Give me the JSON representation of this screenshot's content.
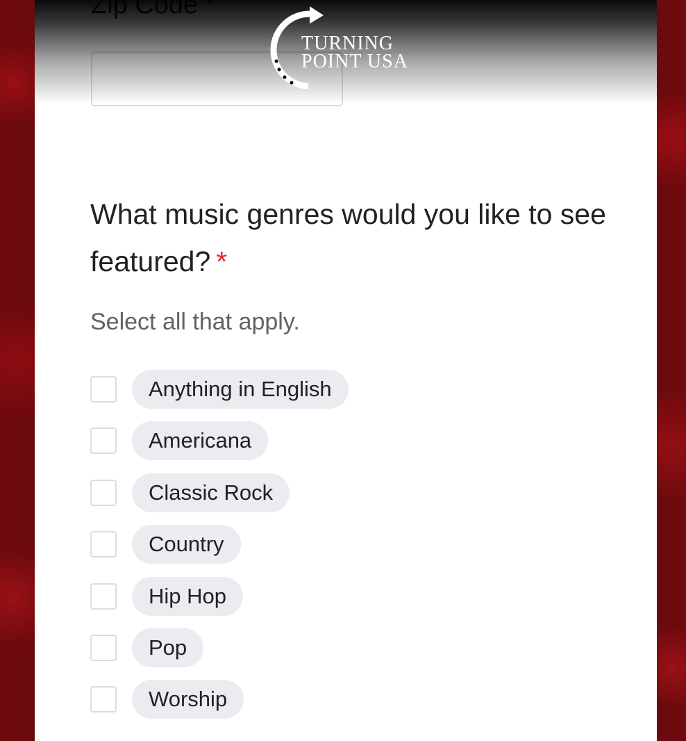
{
  "branding": {
    "logo_line1": "TURNING",
    "logo_line2": "POINT USA"
  },
  "zip": {
    "label": "Zip Code",
    "required_mark": "*",
    "value": ""
  },
  "question": {
    "title": "What music genres would you like to see featured?",
    "required_mark": "*",
    "helper": "Select all that apply."
  },
  "options": [
    {
      "label": "Anything in English",
      "checked": false
    },
    {
      "label": "Americana",
      "checked": false
    },
    {
      "label": "Classic Rock",
      "checked": false
    },
    {
      "label": "Country",
      "checked": false
    },
    {
      "label": "Hip Hop",
      "checked": false
    },
    {
      "label": "Pop",
      "checked": false
    },
    {
      "label": "Worship",
      "checked": false
    }
  ],
  "colors": {
    "required_star": "#d93025",
    "chip_background": "#eaecf0",
    "backdrop": "#6e0a0e"
  }
}
